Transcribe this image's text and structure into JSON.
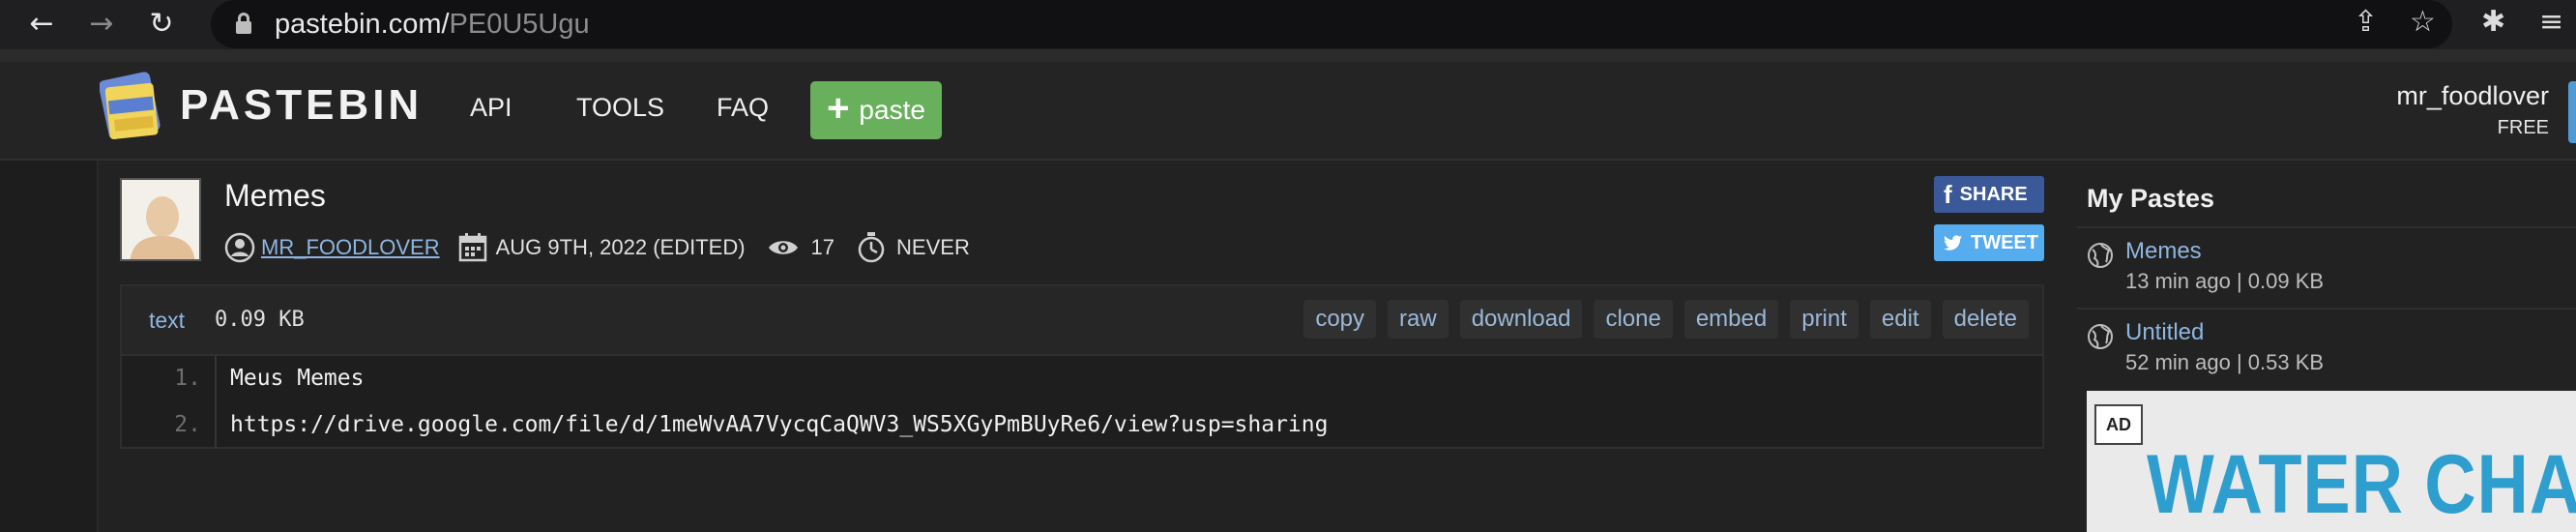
{
  "browser": {
    "url_host": "pastebin.com/",
    "url_path": "PE0U5Ugu",
    "back_icon": "←",
    "forward_icon": "→",
    "reload_icon": "↻",
    "share_icon": "⇪",
    "star_icon": "☆",
    "extensions_icon": "✱",
    "media_icon": "≡"
  },
  "header": {
    "logo_text": "PASTEBIN",
    "menu": [
      "API",
      "TOOLS",
      "FAQ"
    ],
    "paste_button": "paste",
    "user_name": "mr_foodlover",
    "user_plan": "FREE"
  },
  "paste": {
    "title": "Memes",
    "author": "MR_FOODLOVER",
    "date": "AUG 9TH, 2022 (EDITED)",
    "views": "17",
    "expiry": "NEVER",
    "share_label": "SHARE",
    "tweet_label": "TWEET",
    "format": "text",
    "size": "0.09 KB",
    "actions": [
      "copy",
      "raw",
      "download",
      "clone",
      "embed",
      "print",
      "edit",
      "delete"
    ],
    "lines": [
      {
        "num": "1.",
        "text": "Meus Memes"
      },
      {
        "num": "2.",
        "text": "https://drive.google.com/file/d/1meWvAA7VycqCaQWV3_WS5XGyPmBUyRe6/view?usp=sharing"
      }
    ]
  },
  "sidebar": {
    "title": "My Pastes",
    "items": [
      {
        "title": "Memes",
        "meta": "13 min ago | 0.09 KB"
      },
      {
        "title": "Untitled",
        "meta": "52 min ago | 0.53 KB"
      }
    ]
  },
  "ad": {
    "badge": "AD",
    "headline": "WATER CHANGE"
  },
  "colors": {
    "accent_green": "#69b05d",
    "link_blue": "#8fb6e0",
    "facebook": "#3b5998",
    "twitter": "#55acee"
  }
}
